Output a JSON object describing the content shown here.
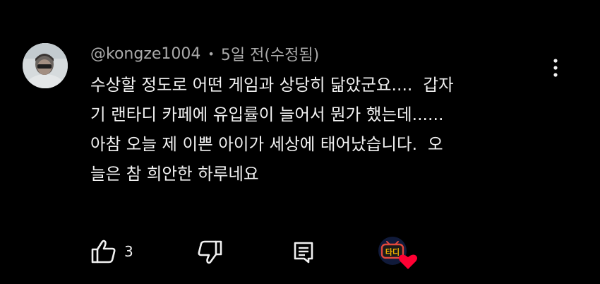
{
  "comment": {
    "author": "@kongze1004",
    "separator": "•",
    "time": "5일 전(수정됨)",
    "lines": [
      "수상할 정도로 어떤 게임과 상당히 닮았군요....  갑자",
      "기 랜타디 카페에 유입률이 늘어서 뭔가 했는데......",
      "아참 오늘 제 이쁜 아이가 세상에 태어났습니다.  오",
      "늘은 참 희안한 하루네요"
    ]
  },
  "actions": {
    "like_icon": "thumbs-up-icon",
    "like_count": "3",
    "dislike_icon": "thumbs-down-icon",
    "reply_icon": "reply-comment-icon",
    "more_icon": "more-vertical-icon"
  },
  "creator_heart": {
    "icon": "creator-heart-icon",
    "badge_text": "타디"
  },
  "colors": {
    "background": "#000000",
    "text": "#f1f1f1",
    "secondary_text": "#aaaaaa",
    "heart": "#ff0033"
  }
}
